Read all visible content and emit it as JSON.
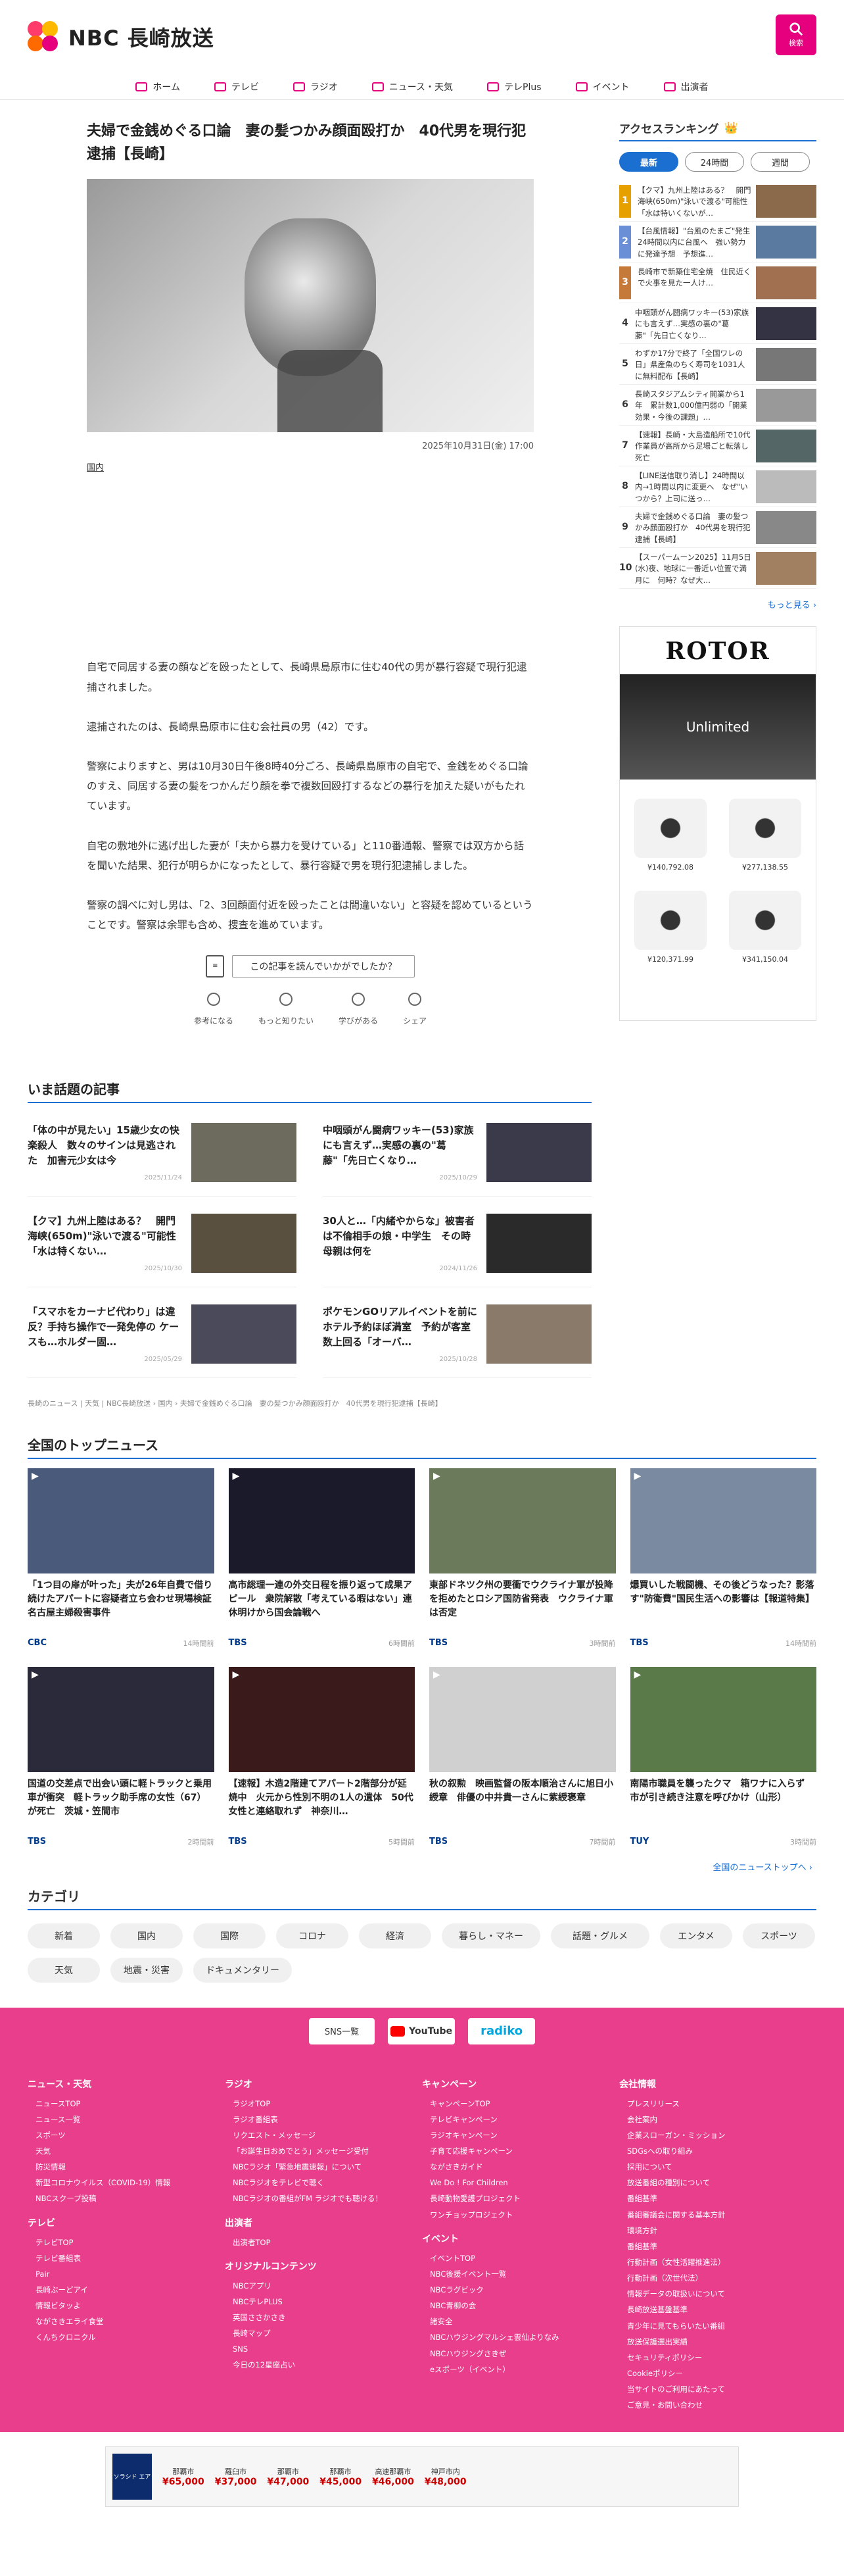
{
  "header": {
    "logo_text": "NBC 長崎放送",
    "search_label": "検索"
  },
  "nav": [
    {
      "label": "ホーム",
      "icon": "home-icon"
    },
    {
      "label": "テレビ",
      "icon": "tv-icon"
    },
    {
      "label": "ラジオ",
      "icon": "radio-icon"
    },
    {
      "label": "ニュース・天気",
      "icon": "news-icon"
    },
    {
      "label": "テレPlus",
      "icon": "teleplus-icon"
    },
    {
      "label": "イベント",
      "icon": "calendar-icon"
    },
    {
      "label": "出演者",
      "icon": "people-icon"
    }
  ],
  "article": {
    "title": "夫婦で金銭めぐる口論　妻の髪つかみ顔面殴打か　40代男を現行犯逮捕【長崎】",
    "date": "2025年10月31日(金) 17:00",
    "category": "国内",
    "paragraphs": [
      "自宅で同居する妻の顔などを殴ったとして、長崎県島原市に住む40代の男が暴行容疑で現行犯逮捕されました。",
      "逮捕されたのは、長崎県島原市に住む会社員の男（42）です。",
      "警察によりますと、男は10月30日午後8時40分ごろ、長崎県島原市の自宅で、金銭をめぐる口論のすえ、同居する妻の髪をつかんだり顔を拳で複数回殴打するなどの暴行を加えた疑いがもたれています。",
      "自宅の敷地外に逃げ出した妻が「夫から暴力を受けている」と110番通報、警察では双方から話を聞いた結果、犯行が明らかになったとして、暴行容疑で男を現行犯逮捕しました。",
      "警察の調べに対し男は、「2、3回顔面付近を殴ったことは間違いない」と容疑を認めているということです。警察は余罪も含め、捜査を進めています。"
    ],
    "feedback_question": "この記事を読んでいかがでしたか？",
    "feedback_buttons": [
      "参考になる",
      "もっと知りたい",
      "学びがある",
      "シェア"
    ]
  },
  "ranking": {
    "title": "アクセスランキング",
    "tabs": [
      "最新",
      "24時間",
      "週間"
    ],
    "items": [
      {
        "num": "1",
        "text": "【クマ】九州上陸はある？　開門海峡(650m)\"泳いで渡る\"可能性「水は特いくないが…",
        "color": "#e6a100"
      },
      {
        "num": "2",
        "text": "【台風情報】\"台風のたまご\"発生　24時間以内に台風へ　強い勢力に発達予想　予想進…",
        "color": "#6b8fd6"
      },
      {
        "num": "3",
        "text": "長崎市で新築住宅全焼　住民近くで火事を見た一人け…",
        "color": "#c67a3a"
      },
      {
        "num": "4",
        "text": "中咽頭がん闘病ワッキー(53)家族にも言えず…実感の裏の\"葛藤\"「先日亡くなり…",
        "color": ""
      },
      {
        "num": "5",
        "text": "わずか17分で終了「全国ワレの日」県産魚のちく寿司を1031人に無料配布【長崎】",
        "color": ""
      },
      {
        "num": "6",
        "text": "長崎スタジアムシティ開業から1年　累計数1,000億円弱の「開業効果・今後の課題」…",
        "color": ""
      },
      {
        "num": "7",
        "text": "【速報】長崎・大島造船所で10代作業員が高所から足場ごと転落し死亡",
        "color": ""
      },
      {
        "num": "8",
        "text": "【LINE送信取り消し】24時間以内→1時間以内に変更へ　なぜ\"いつから？上司に送っ…",
        "color": ""
      },
      {
        "num": "9",
        "text": "夫婦で金銭めぐる口論　妻の髪つかみ顔面殴打か　40代男を現行犯逮捕【長崎】",
        "color": ""
      },
      {
        "num": "10",
        "text": "【スーパームーン2025】11月5日(水)夜、地球に一番近い位置で満月に　何時？なぜ大…",
        "color": ""
      }
    ],
    "more": "もっと見る ›"
  },
  "ad": {
    "brand": "ROTOR",
    "banner_text": "Unlimited",
    "prices": [
      "¥140,792.08",
      "¥277,138.55",
      "¥120,371.99",
      "¥341,150.04"
    ]
  },
  "topics": {
    "title": "いま話題の記事",
    "items": [
      {
        "title": "「体の中が見たい」15歳少女の快楽殺人　数々のサインは見逃された　加害元少女は今",
        "date": "2025/11/24",
        "thumb": "#6d6a5e"
      },
      {
        "title": "中咽頭がん闘病ワッキー(53)家族にも言えず…実感の裏の\"葛藤\"「先日亡くなり…",
        "date": "2025/10/29",
        "thumb": "#3a3a4a"
      },
      {
        "title": "【クマ】九州上陸はある？　開門海峡(650m)\"泳いで渡る\"可能性「水は特くない…",
        "date": "2025/10/30",
        "thumb": "#5a5040"
      },
      {
        "title": "30人と…「内緒やからな」被害者は不倫相手の娘・中学生　その時母親は何を",
        "date": "2024/11/26",
        "thumb": "#2a2a2a"
      },
      {
        "title": "「スマホをカーナビ代わり」は違反？手持ち操作で一発免停の ケースも…ホルダー固…",
        "date": "2025/05/29",
        "thumb": "#4a4a5a"
      },
      {
        "title": "ポケモンGOリアルイベントを前にホテル予約ほぼ満室　予約が客室数上回る「オーバ…",
        "date": "2025/10/28",
        "thumb": "#8a7a6a"
      }
    ]
  },
  "breadcrumb": "長崎のニュース | 天気 | NBC長崎放送 › 国内 › 夫婦で金銭めぐる口論　妻の髪つかみ顔面殴打か　40代男を現行犯逮捕【長崎】",
  "national": {
    "title": "全国のトップニュース",
    "items": [
      {
        "title": "「1つ目の扉が叶った」夫が26年自費で借り続けたアパートに容疑者立ち会わせ現場検証　名古屋主婦殺害事件",
        "source": "CBC",
        "time": "14時間前",
        "img": "#4a5a7a"
      },
      {
        "title": "高市総理一連の外交日程を振り返って成果アピール　衆院解散「考えている暇はない」連休明けから国会論戦へ",
        "source": "TBS",
        "time": "6時間前",
        "img": "#1a1a2a"
      },
      {
        "title": "東部ドネツク州の要衝でウクライナ軍が投降を拒めたとロシア国防省発表　ウクライナ軍は否定",
        "source": "TBS",
        "time": "3時間前",
        "img": "#6a7a5a"
      },
      {
        "title": "爆買いした戦闘機、その後どうなった？影落す\"防衛費\"国民生活への影響は【報道特集】",
        "source": "TBS",
        "time": "14時間前",
        "img": "#7a8aa0"
      },
      {
        "title": "国道の交差点で出会い頭に軽トラックと乗用車が衝突　軽トラック助手席の女性（67）が死亡　茨城・笠間市",
        "source": "TBS",
        "time": "2時間前",
        "img": "#2a2a3a"
      },
      {
        "title": "【速報】木造2階建てアパート2階部分が延焼中　火元から性別不明の1人の遺体　50代女性と連絡取れず　神奈川…",
        "source": "TBS",
        "time": "5時間前",
        "img": "#3a1a1a"
      },
      {
        "title": "秋の叙勲　映画監督の阪本順治さんに旭日小綬章　俳優の中井貴一さんに紫綬褒章",
        "source": "TBS",
        "time": "7時間前",
        "img": "#d0d0d0"
      },
      {
        "title": "南陽市職員を襲ったクマ　箱ワナに入らず　市が引き続き注意を呼びかけ（山形）",
        "source": "TUY",
        "time": "3時間前",
        "img": "#5a7a4a"
      }
    ],
    "more": "全国のニューストップへ ›"
  },
  "categories": {
    "title": "カテゴリ",
    "items": [
      "新着",
      "国内",
      "国際",
      "コロナ",
      "経済",
      "暮らし・マネー",
      "話題・グルメ",
      "エンタメ",
      "スポーツ",
      "天気",
      "地震・災害",
      "ドキュメンタリー"
    ]
  },
  "footer": {
    "sns_label": "SNS一覧",
    "youtube": "YouTube",
    "radiko": "radiko",
    "columns": [
      [
        {
          "head": "ニュース・天気",
          "links": [
            "ニュースTOP",
            "ニュース一覧",
            "スポーツ",
            "天気",
            "防災情報",
            "新型コロナウイルス（COVID-19）情報",
            "NBCスクープ投稿"
          ]
        },
        {
          "head": "テレビ",
          "links": [
            "テレビTOP",
            "テレビ番組表",
            "Pair",
            "長崎ぶーどアイ",
            "情報ビタッよ",
            "ながさきエライ食堂",
            "くんちクロニクル"
          ]
        }
      ],
      [
        {
          "head": "ラジオ",
          "links": [
            "ラジオTOP",
            "ラジオ番組表",
            "リクエスト・メッセージ",
            "「お誕生日おめでとう」メッセージ受付",
            "NBCラジオ「緊急地震速報」について",
            "NBCラジオをテレビで聴く",
            "NBCラジオの番組がFM ラジオでも聴ける！"
          ]
        },
        {
          "head": "出演者",
          "links": [
            "出演者TOP"
          ]
        },
        {
          "head": "オリジナルコンテンツ",
          "links": [
            "NBCアプリ",
            "NBCテレPLUS",
            "英国ささかさき",
            "長崎マップ",
            "SNS",
            "今日の12星座占い"
          ]
        }
      ],
      [
        {
          "head": "キャンペーン",
          "links": [
            "キャンペーンTOP",
            "テレビキャンペーン",
            "ラジオキャンペーン",
            "子育て応援キャンペーン",
            "ながさきガイド",
            "We Do ! For Children",
            "長崎動物愛護プロジェクト",
            "ワンチョップロジェクト"
          ]
        },
        {
          "head": "イベント",
          "links": [
            "イベントTOP",
            "NBC後援イベント一覧",
            "NBCラグビック",
            "NBC青柳の会",
            "諸安全",
            "NBCハウジングマルシェ雲仙よりなみ",
            "NBCハウジングさきぜ",
            "eスポーツ（イベント）"
          ]
        }
      ],
      [
        {
          "head": "会社情報",
          "links": [
            "プレスリリース",
            "会社案内",
            "企業スローガン・ミッション",
            "SDGsへの取り組み",
            "採用について",
            "放送番組の種別について",
            "番組基準",
            "番組審議会に関する基本方針",
            "環境方針",
            "番組基準",
            "行動計画（女性活躍推進法）",
            "行動計画（次世代法）",
            "情報データの取扱いについて",
            "長崎放送基盤基準",
            "青少年に見てもらいたい番組",
            "放送保護選出実績",
            "セキュリティポリシー",
            "Cookieポリシー",
            "当サイトのご利用にあたって",
            "ご意見・お問い合わせ"
          ]
        }
      ]
    ]
  },
  "bottom_ad": {
    "brand": "ソラシド エア",
    "items": [
      {
        "city": "那覇市",
        "price": "¥65,000"
      },
      {
        "city": "羅臼市",
        "price": "¥37,000"
      },
      {
        "city": "那覇市",
        "price": "¥47,000"
      },
      {
        "city": "那覇市",
        "price": "¥45,000"
      },
      {
        "city": "高速那覇市",
        "price": "¥46,000"
      },
      {
        "city": "神戸市内",
        "price": "¥48,000"
      }
    ]
  },
  "colors": {
    "brand_pink": "#e6007e",
    "footer_pink": "#e83e8c",
    "accent_blue": "#1a6fd1"
  }
}
